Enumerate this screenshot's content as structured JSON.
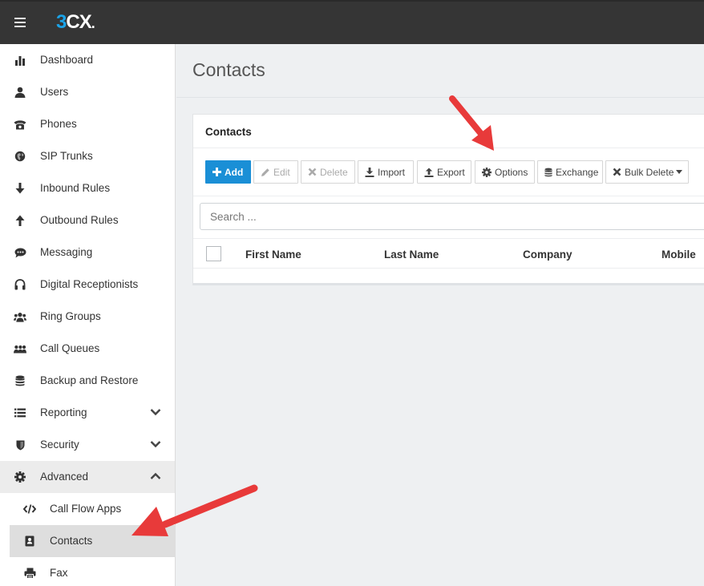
{
  "app": {
    "logo_main": "3",
    "logo_cx": "CX",
    "logo_dot": "."
  },
  "sidebar": {
    "items": [
      {
        "label": "Dashboard",
        "icon": "bar-chart-icon"
      },
      {
        "label": "Users",
        "icon": "user-icon"
      },
      {
        "label": "Phones",
        "icon": "phone-icon"
      },
      {
        "label": "SIP Trunks",
        "icon": "globe-icon"
      },
      {
        "label": "Inbound Rules",
        "icon": "arrow-down-icon"
      },
      {
        "label": "Outbound Rules",
        "icon": "arrow-up-icon"
      },
      {
        "label": "Messaging",
        "icon": "chat-bubble-icon"
      },
      {
        "label": "Digital Receptionists",
        "icon": "headset-icon"
      },
      {
        "label": "Ring Groups",
        "icon": "group-icon"
      },
      {
        "label": "Call Queues",
        "icon": "queue-people-icon"
      },
      {
        "label": "Backup and Restore",
        "icon": "database-icon"
      },
      {
        "label": "Reporting",
        "icon": "list-icon"
      },
      {
        "label": "Security",
        "icon": "shield-icon"
      },
      {
        "label": "Advanced",
        "icon": "gear-icon"
      },
      {
        "label": "Call Flow Apps",
        "icon": "code-icon"
      },
      {
        "label": "Contacts",
        "icon": "address-book-icon"
      },
      {
        "label": "Fax",
        "icon": "printer-icon"
      }
    ]
  },
  "main": {
    "title": "Contacts",
    "panel": {
      "title": "Contacts",
      "toolbar": {
        "add": "Add",
        "edit": "Edit",
        "delete": "Delete",
        "import": "Import",
        "export": "Export",
        "options": "Options",
        "exchange": "Exchange",
        "bulk_delete": "Bulk Delete"
      },
      "search": {
        "placeholder": "Search ..."
      },
      "columns": [
        "First Name",
        "Last Name",
        "Company",
        "Mobile"
      ]
    }
  },
  "colors": {
    "topbar": "#353535",
    "accent": "#1a8fd6",
    "logo_blue": "#1aa3e8",
    "annotation_arrow": "#e83a3a"
  }
}
